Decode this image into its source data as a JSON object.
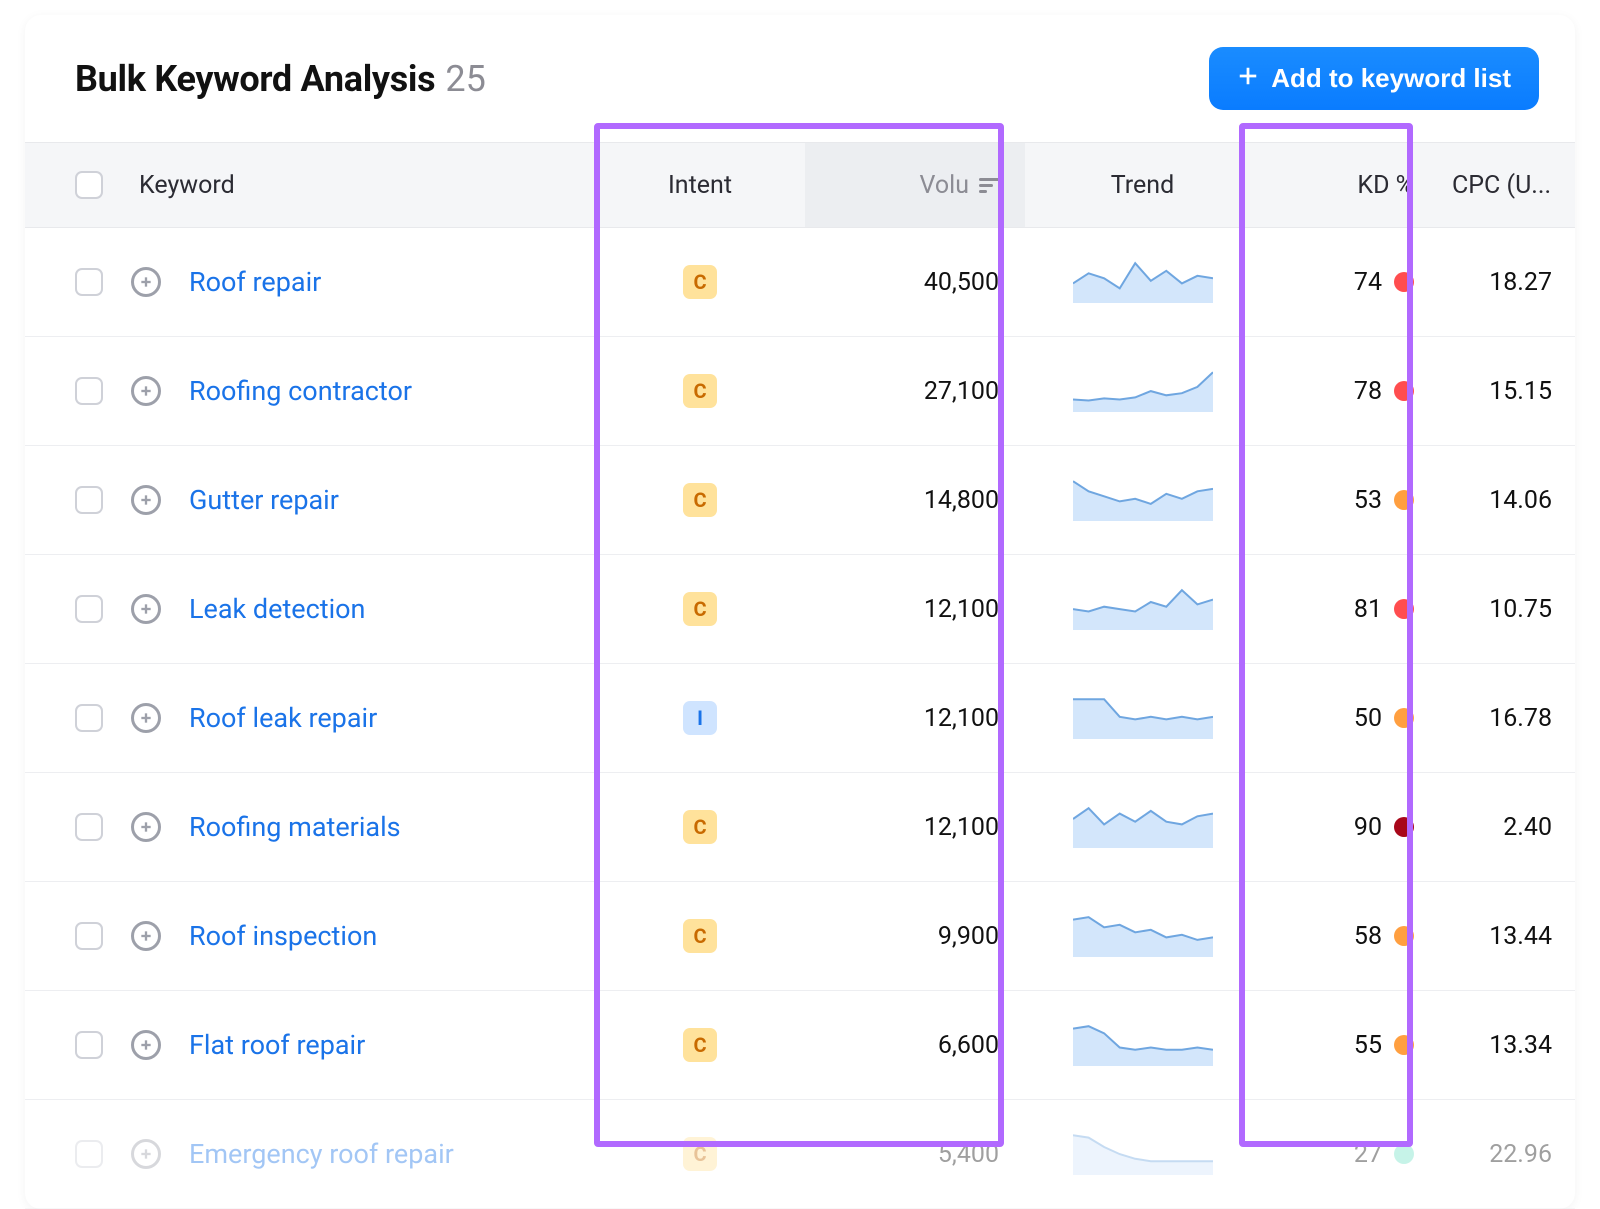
{
  "header": {
    "title": "Bulk Keyword Analysis",
    "count": "25",
    "add_button": "Add to keyword list"
  },
  "columns": {
    "keyword": "Keyword",
    "intent": "Intent",
    "volume": "Volu",
    "trend": "Trend",
    "kd": "KD %",
    "cpc": "CPC (U..."
  },
  "rows": [
    {
      "keyword": "Roof repair",
      "intent": "C",
      "volume": "40,500",
      "kd": "74",
      "kd_class": "kd-red",
      "cpc": "18.27",
      "trend": [
        14,
        22,
        18,
        10,
        30,
        16,
        24,
        14,
        20,
        18
      ]
    },
    {
      "keyword": "Roofing contractor",
      "intent": "C",
      "volume": "27,100",
      "kd": "78",
      "kd_class": "kd-red",
      "cpc": "15.15",
      "trend": [
        10,
        9,
        11,
        10,
        12,
        18,
        14,
        16,
        22,
        36
      ]
    },
    {
      "keyword": "Gutter repair",
      "intent": "C",
      "volume": "14,800",
      "kd": "53",
      "kd_class": "kd-orange",
      "cpc": "14.06",
      "trend": [
        30,
        22,
        18,
        14,
        16,
        12,
        20,
        16,
        22,
        24
      ]
    },
    {
      "keyword": "Leak detection",
      "intent": "C",
      "volume": "12,100",
      "kd": "81",
      "kd_class": "kd-red",
      "cpc": "10.75",
      "trend": [
        16,
        14,
        18,
        16,
        14,
        22,
        18,
        32,
        20,
        24
      ]
    },
    {
      "keyword": "Roof leak repair",
      "intent": "I",
      "volume": "12,100",
      "kd": "50",
      "kd_class": "kd-orange",
      "cpc": "16.78",
      "trend": [
        30,
        30,
        30,
        16,
        14,
        16,
        14,
        16,
        14,
        16
      ]
    },
    {
      "keyword": "Roofing materials",
      "intent": "C",
      "volume": "12,100",
      "kd": "90",
      "kd_class": "kd-darkred",
      "cpc": "2.40",
      "trend": [
        20,
        28,
        16,
        24,
        18,
        26,
        18,
        16,
        22,
        24
      ]
    },
    {
      "keyword": "Roof inspection",
      "intent": "C",
      "volume": "9,900",
      "kd": "58",
      "kd_class": "kd-orange",
      "cpc": "13.44",
      "trend": [
        28,
        30,
        22,
        24,
        18,
        20,
        14,
        16,
        12,
        14
      ]
    },
    {
      "keyword": "Flat roof repair",
      "intent": "C",
      "volume": "6,600",
      "kd": "55",
      "kd_class": "kd-orange",
      "cpc": "13.34",
      "trend": [
        30,
        32,
        26,
        14,
        12,
        14,
        12,
        12,
        14,
        12
      ]
    },
    {
      "keyword": "Emergency roof repair",
      "intent": "C",
      "volume": "5,400",
      "kd": "27",
      "kd_class": "kd-green",
      "cpc": "22.96",
      "trend": [
        32,
        30,
        22,
        16,
        12,
        10,
        10,
        10,
        10,
        10
      ],
      "faded": true
    }
  ]
}
